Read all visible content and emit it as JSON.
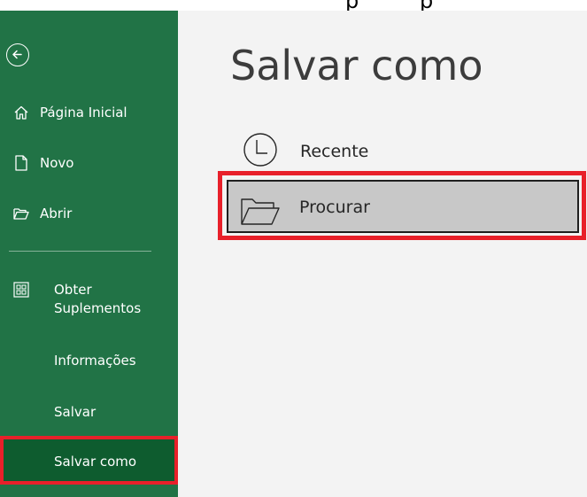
{
  "app": {
    "page_title": "Salvar como",
    "theme": {
      "sidebar_bg": "#217346",
      "sidebar_selected_bg": "#0e5c2f",
      "main_bg": "#f3f3f3",
      "highlight_border": "#e8202a",
      "selected_option_bg": "#c8c8c8"
    }
  },
  "sidebar": {
    "back_icon": "back-arrow-circle-icon",
    "items": [
      {
        "label": "Página Inicial",
        "icon": "home-icon"
      },
      {
        "label": "Novo",
        "icon": "new-document-icon"
      },
      {
        "label": "Abrir",
        "icon": "open-folder-icon"
      },
      {
        "label": "Obter Suplementos",
        "icon": "add-ins-grid-icon"
      },
      {
        "label": "Informações",
        "icon": ""
      },
      {
        "label": "Salvar",
        "icon": ""
      },
      {
        "label": "Salvar como",
        "icon": "",
        "selected": true
      }
    ]
  },
  "main": {
    "title": "Salvar como",
    "options": [
      {
        "label": "Recente",
        "icon": "clock-icon"
      },
      {
        "label": "Procurar",
        "icon": "folder-icon",
        "selected": true
      }
    ]
  }
}
